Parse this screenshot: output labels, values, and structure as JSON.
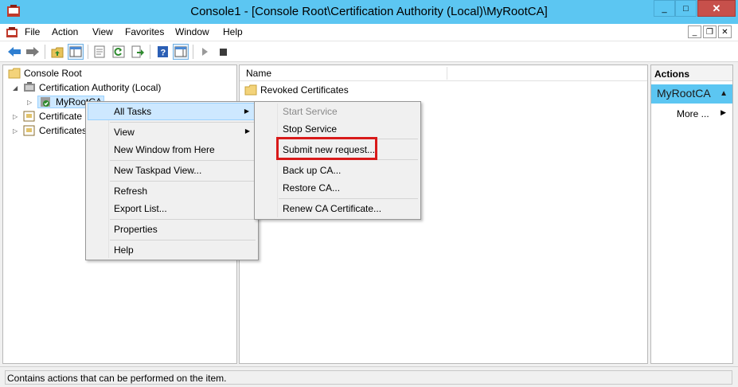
{
  "window": {
    "title": "Console1 - [Console Root\\Certification Authority (Local)\\MyRootCA]",
    "min_glyph": "_",
    "max_glyph": "□",
    "close_glyph": "✕"
  },
  "menu": {
    "items": [
      "File",
      "Action",
      "View",
      "Favorites",
      "Window",
      "Help"
    ],
    "inner_min": "_",
    "inner_restore": "❐",
    "inner_close": "✕"
  },
  "tree": {
    "root": "Console Root",
    "ca": "Certification Authority (Local)",
    "myroot": "MyRootCA",
    "certificate_item": "Certificate",
    "certificates_item": "Certificates"
  },
  "list": {
    "column_name": "Name",
    "rows": [
      "Revoked Certificates"
    ]
  },
  "actions": {
    "title": "Actions",
    "group": "MyRootCA",
    "more": "More ...",
    "group_arrow": "▲",
    "more_arrow": "▶"
  },
  "context_menu": {
    "items": [
      "All Tasks",
      "View",
      "New Window from Here",
      "New Taskpad View...",
      "Refresh",
      "Export List...",
      "Properties",
      "Help"
    ],
    "arrow": "▶"
  },
  "submenu": {
    "items": [
      "Start Service",
      "Stop Service",
      "Submit new request...",
      "Back up CA...",
      "Restore CA...",
      "Renew CA Certificate..."
    ]
  },
  "status": "Contains actions that can be performed on the item.",
  "colors": {
    "title_bar": "#5cc6f2",
    "close_button": "#c7504b",
    "selection": "#cde8ff",
    "annotation_box": "#d81a1a"
  },
  "icons": [
    "app-icon",
    "mmc-icon",
    "back-arrow-icon",
    "forward-arrow-icon",
    "up-folder-icon",
    "show-hide-tree-icon",
    "properties-icon",
    "refresh-icon",
    "export-icon",
    "help-icon",
    "action-pane-icon",
    "play-icon",
    "stop-icon",
    "folder-icon",
    "ca-icon",
    "certificate-icon"
  ]
}
